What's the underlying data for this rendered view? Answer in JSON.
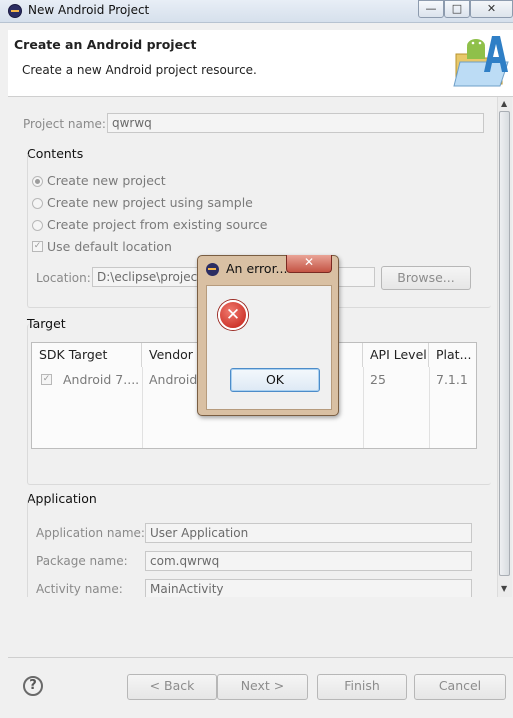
{
  "window": {
    "title": "New Android Project",
    "buttons": {
      "minimize": "—",
      "maximize": "□",
      "close": "✕"
    }
  },
  "header": {
    "title": "Create an Android project",
    "subtitle": "Create a new Android project resource."
  },
  "project": {
    "name_label": "Project name:",
    "name_value": "qwrwq"
  },
  "contents": {
    "title": "Contents",
    "options": [
      {
        "label": "Create new project",
        "selected": true
      },
      {
        "label": "Create new project using sample",
        "selected": false
      },
      {
        "label": "Create project from existing source",
        "selected": false
      }
    ],
    "use_default_location": "Use default location",
    "location_label": "Location:",
    "location_value": "D:\\eclipse\\projec",
    "browse_label": "Browse..."
  },
  "target": {
    "title": "Target",
    "columns": [
      "SDK Target",
      "Vendor",
      "API Level",
      "Plat..."
    ],
    "rows": [
      {
        "checked": true,
        "sdk": "Android 7....",
        "vendor": "Android",
        "api": "25",
        "platform": "7.1.1"
      }
    ]
  },
  "application": {
    "title": "Application",
    "app_name_label": "Application name:",
    "app_name_value": "User Application",
    "package_label": "Package name:",
    "package_value": "com.qwrwq",
    "activity_label": "Activity name:",
    "activity_value": "MainActivity"
  },
  "footer": {
    "help": "?",
    "back": "< Back",
    "next": "Next >",
    "finish": "Finish",
    "cancel": "Cancel"
  },
  "dialog": {
    "title": "An error...",
    "close": "✕",
    "ok": "OK",
    "icon": "error-icon"
  },
  "colors": {
    "dialog_frame": "#d9c0a3",
    "error_red": "#c21d14",
    "banner_green": "#8fc04a",
    "banner_blue": "#2f7fc6"
  }
}
